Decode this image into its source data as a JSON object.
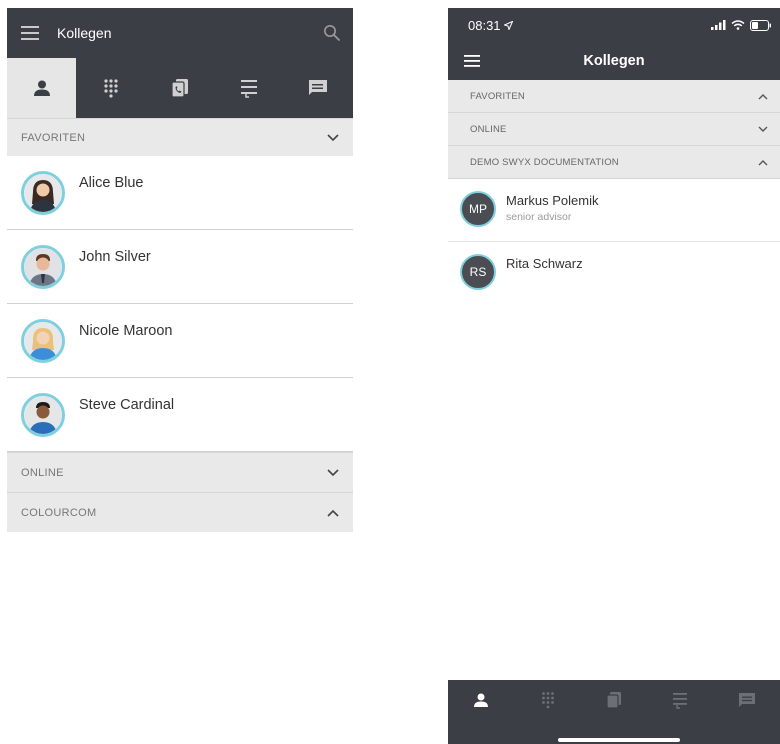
{
  "android": {
    "appbar": {
      "title": "Kollegen",
      "menu_icon": "menu-icon",
      "search_icon": "search-icon"
    },
    "tabs": [
      {
        "icon": "person-icon",
        "active": true
      },
      {
        "icon": "dialpad-icon",
        "active": false
      },
      {
        "icon": "call-history-icon",
        "active": false
      },
      {
        "icon": "voicemail-list-icon",
        "active": false
      },
      {
        "icon": "chat-icon",
        "active": false
      }
    ],
    "sections": {
      "favoriten": {
        "label": "FAVORITEN",
        "state": "expanded"
      },
      "online": {
        "label": "ONLINE",
        "state": "collapsed"
      },
      "colourcom": {
        "label": "COLOURCOM",
        "state": "expanded"
      }
    },
    "contacts": [
      {
        "name": "Alice Blue"
      },
      {
        "name": "John Silver"
      },
      {
        "name": "Nicole Maroon"
      },
      {
        "name": "Steve Cardinal"
      }
    ]
  },
  "ios": {
    "status": {
      "time": "08:31"
    },
    "nav": {
      "title": "Kollegen"
    },
    "sections": {
      "favoriten": {
        "label": "FAVORITEN"
      },
      "online": {
        "label": "ONLINE"
      },
      "demo": {
        "label": "DEMO SWYX DOCUMENTATION"
      }
    },
    "contacts": [
      {
        "initials": "MP",
        "name": "Markus Polemik",
        "subtitle": "senior advisor"
      },
      {
        "initials": "RS",
        "name": "Rita Schwarz",
        "subtitle": ""
      }
    ]
  },
  "colors": {
    "bar": "#3b3f45",
    "section": "#e9e9e9",
    "avatar_ring": "#7fd0de"
  }
}
